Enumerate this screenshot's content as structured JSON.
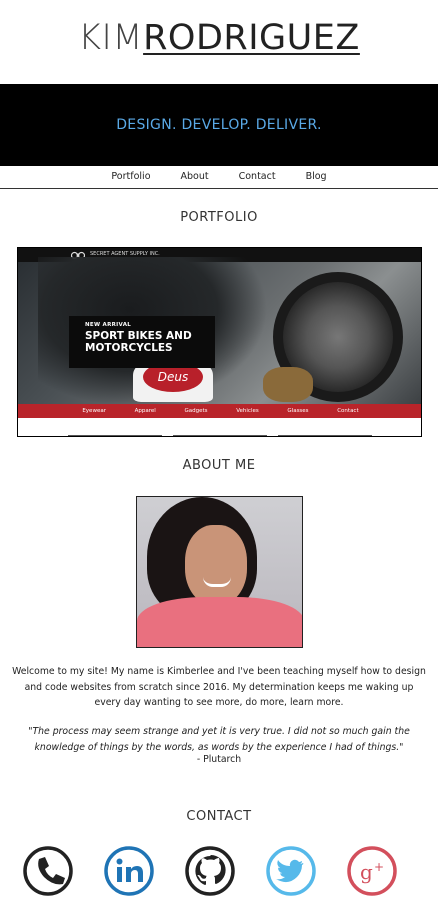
{
  "header": {
    "first_name": "KIM",
    "last_name": "RODRIGUEZ"
  },
  "hero": {
    "tagline": "DESIGN. DEVELOP. DELIVER."
  },
  "nav": {
    "items": [
      "Portfolio",
      "About",
      "Contact",
      "Blog"
    ]
  },
  "portfolio": {
    "title": "PORTFOLIO",
    "preview": {
      "brand": "SECRET AGENT SUPPLY INC.",
      "badge_kicker": "NEW ARRIVAL",
      "badge_line1": "SPORT BIKES AND",
      "badge_line2": "MOTORCYCLES",
      "tank_logo": "Deus",
      "menu": [
        "Eyewear",
        "Apparel",
        "Gadgets",
        "Vehicles",
        "Glasses",
        "Contact"
      ]
    }
  },
  "about": {
    "title": "ABOUT ME",
    "bio": "Welcome to my site! My name is Kimberlee and I've been teaching myself how to design and code websites from scratch since 2016. My determination keeps me waking up every day wanting to see more, do more, learn more.",
    "quote": "\"The process may seem strange and yet it is very true. I did not so much gain the knowledge of things by the words, as words by the experience I had of things.\"",
    "quote_author": "- Plutarch"
  },
  "contact": {
    "title": "CONTACT",
    "icons": [
      {
        "name": "phone-icon",
        "color": "#222222"
      },
      {
        "name": "linkedin-icon",
        "color": "#1f74b5"
      },
      {
        "name": "github-icon",
        "color": "#222222"
      },
      {
        "name": "twitter-icon",
        "color": "#56b9ea"
      },
      {
        "name": "google-plus-icon",
        "color": "#d34f5c"
      }
    ]
  }
}
